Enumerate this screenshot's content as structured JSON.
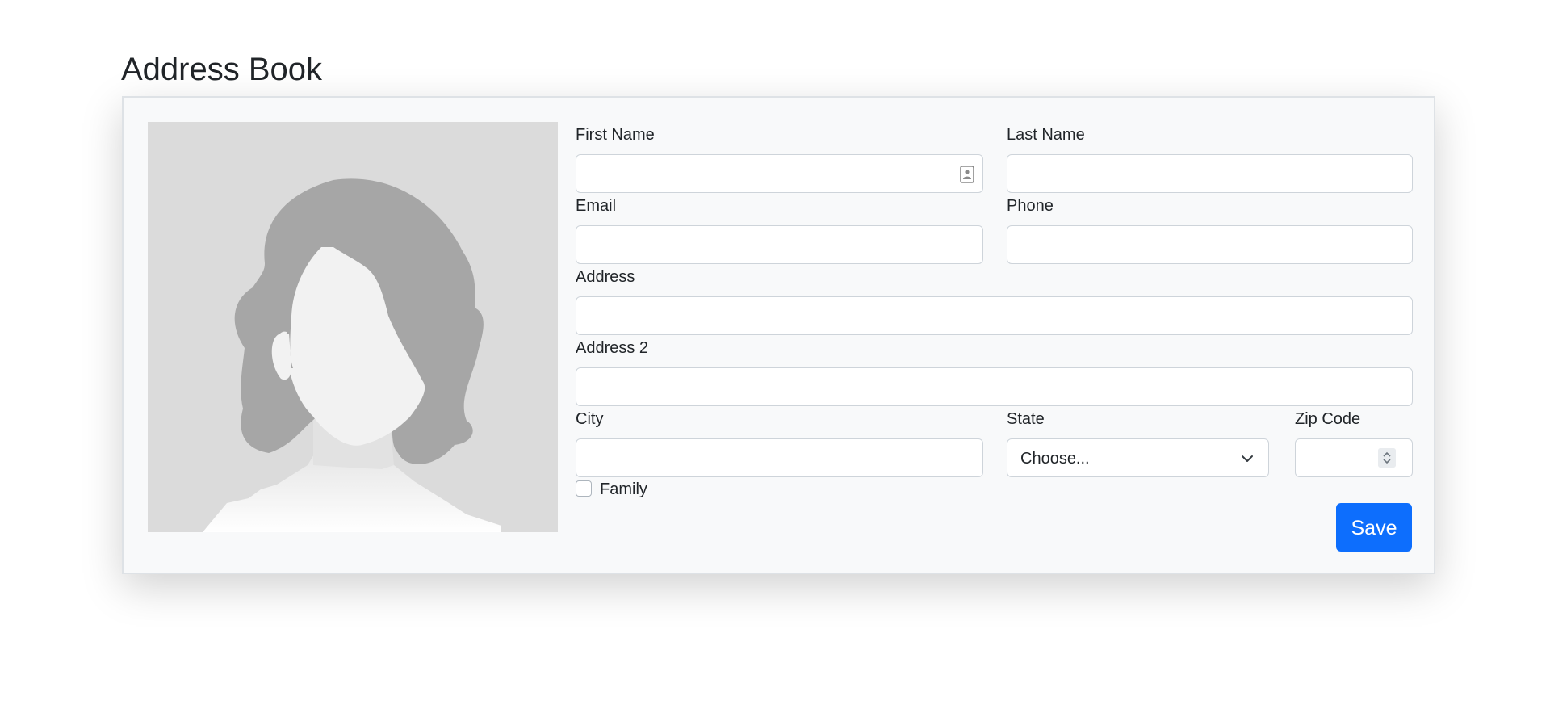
{
  "page": {
    "title": "Address Book"
  },
  "form": {
    "first_name": {
      "label": "First Name",
      "value": ""
    },
    "last_name": {
      "label": "Last Name",
      "value": ""
    },
    "email": {
      "label": "Email",
      "value": ""
    },
    "phone": {
      "label": "Phone",
      "value": ""
    },
    "address": {
      "label": "Address",
      "value": ""
    },
    "address2": {
      "label": "Address 2",
      "value": ""
    },
    "city": {
      "label": "City",
      "value": ""
    },
    "state": {
      "label": "State",
      "selected": "Choose..."
    },
    "zip": {
      "label": "Zip Code",
      "value": ""
    },
    "family": {
      "label": "Family",
      "checked": false
    },
    "save_label": "Save"
  },
  "icons": {
    "avatar": "person-silhouette-icon",
    "contact_autofill": "contact-card-icon",
    "select_chevron": "chevron-down-icon",
    "zip_spinner": "spinner-arrows-icon"
  },
  "colors": {
    "primary": "#0d6efd",
    "card_background": "#f8f9fa",
    "avatar_background": "#dbdbdb",
    "silhouette_hair": "#a6a6a6",
    "silhouette_face": "#f2f2f2"
  }
}
